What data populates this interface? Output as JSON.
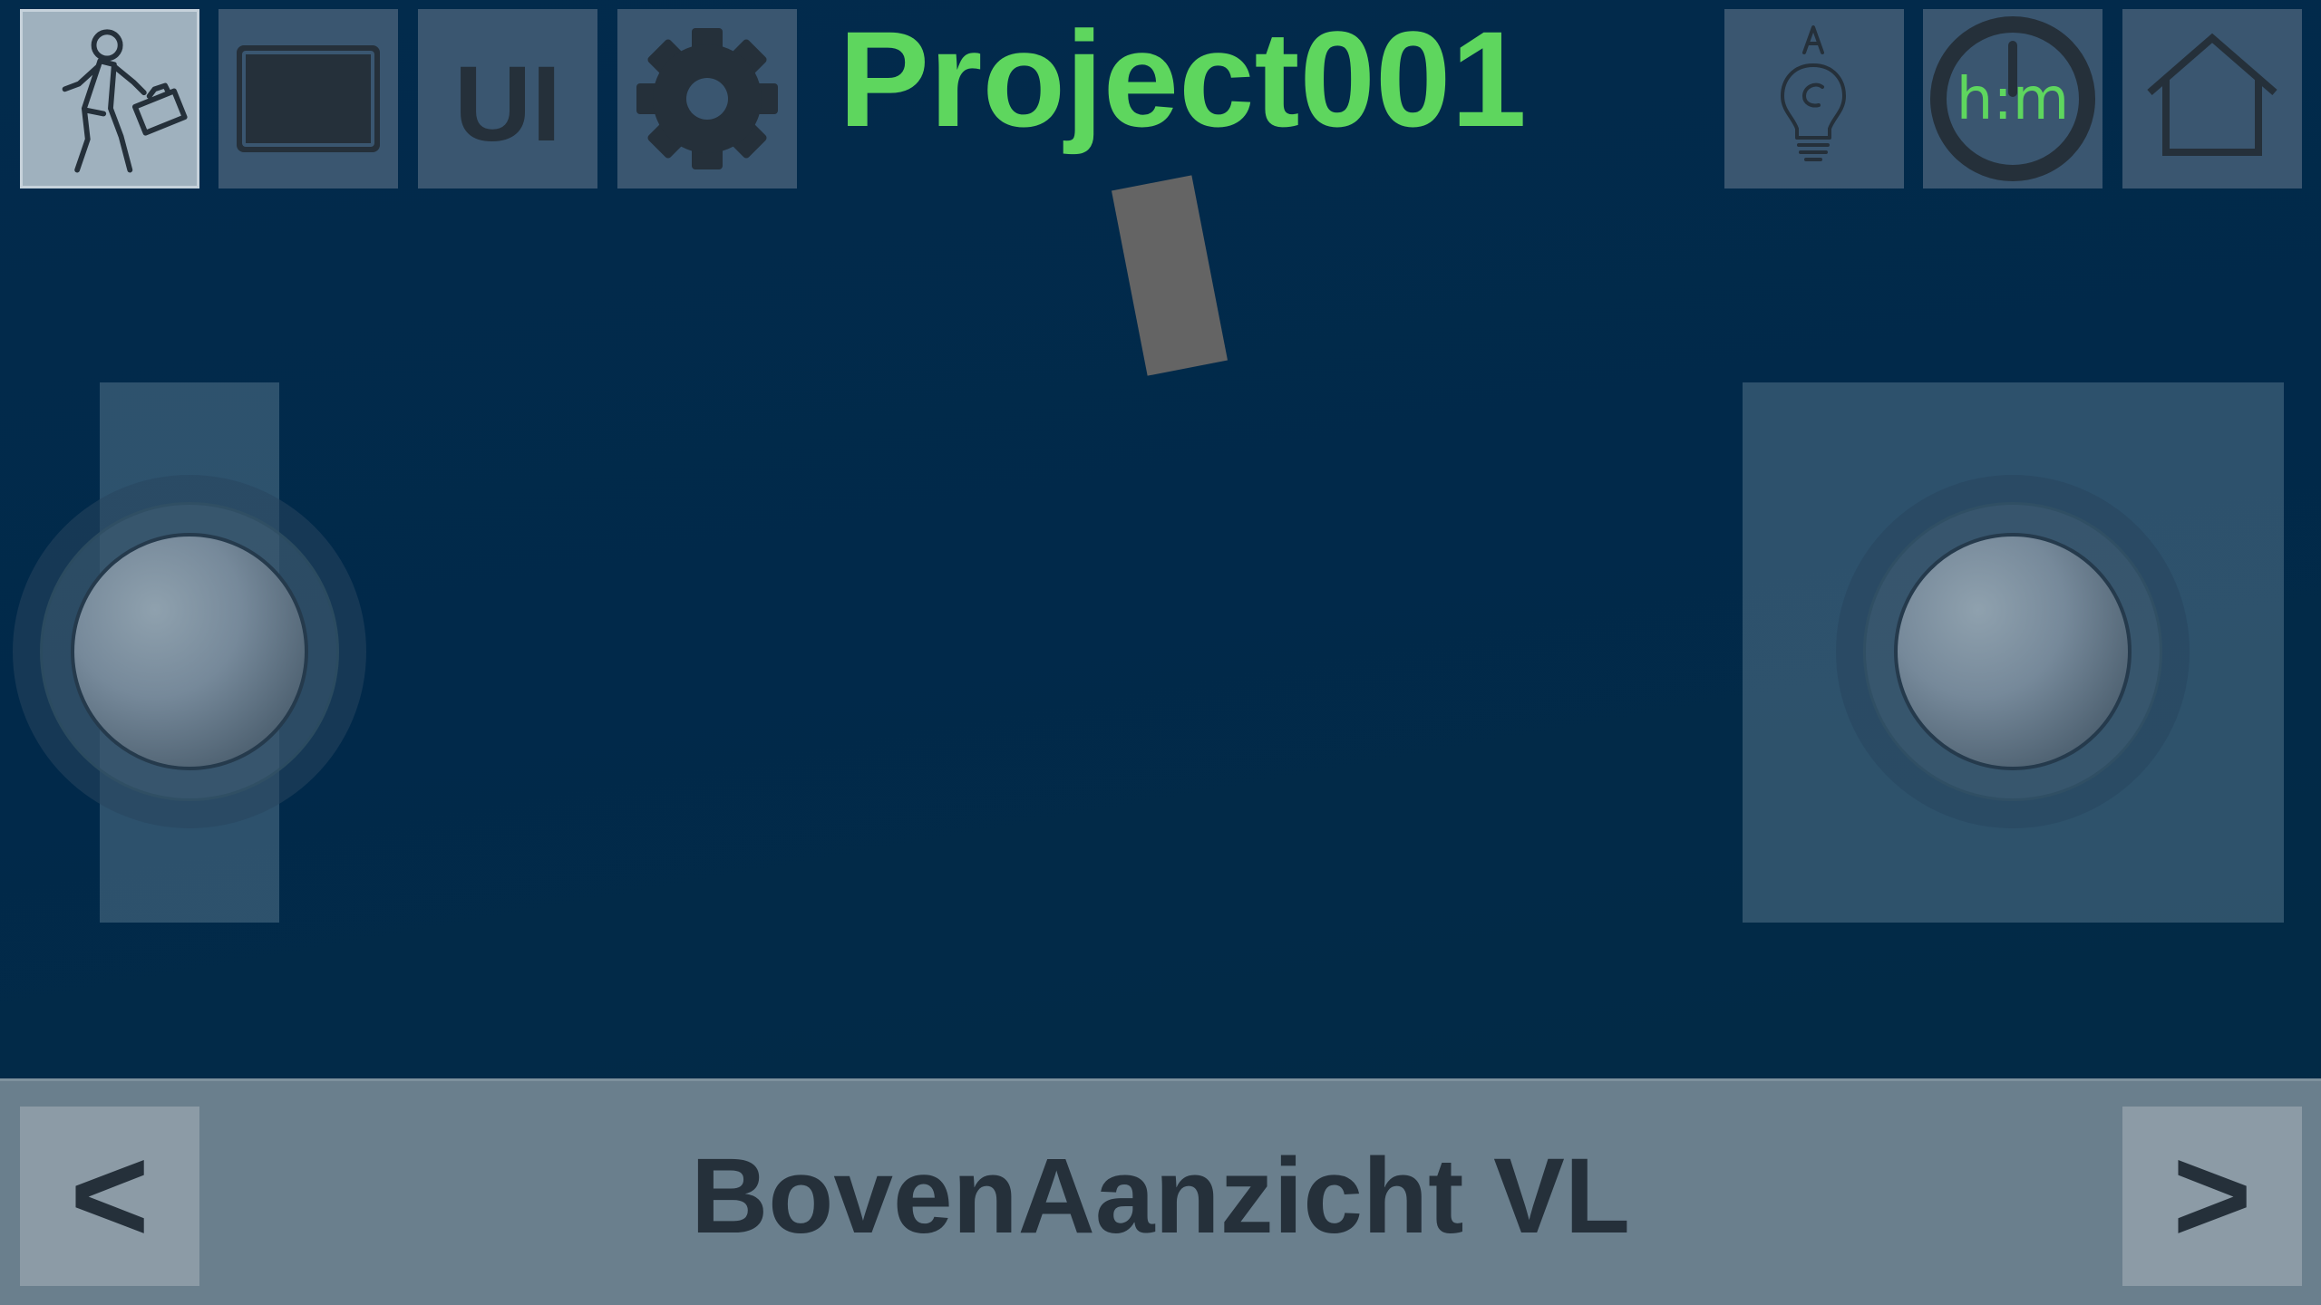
{
  "header": {
    "title": "Project001",
    "title_color": "#5ed65e",
    "toolbar_left": [
      {
        "name": "walk-mode-button",
        "icon": "walking-person-with-briefcase-icon",
        "active": true
      },
      {
        "name": "screen-button",
        "icon": "monitor-screen-icon",
        "active": false
      },
      {
        "name": "ui-button",
        "label": "UI",
        "active": false
      },
      {
        "name": "settings-button",
        "icon": "gear-icon",
        "active": false
      }
    ],
    "toolbar_right": [
      {
        "name": "light-button",
        "icon": "lightbulb-auto-icon",
        "icon_letter": "A"
      },
      {
        "name": "clock-button",
        "icon": "clock-icon",
        "label": "h:m"
      },
      {
        "name": "home-button",
        "icon": "home-icon"
      }
    ]
  },
  "view": {
    "name": "BovenAanzicht VL",
    "prev_label": "<",
    "next_label": ">"
  },
  "colors": {
    "background": "#022b4c",
    "button": "#3a5670",
    "button_active": "#9fb1be",
    "bottom_bar": "#6a7f8d",
    "accent_green": "#5ed65e",
    "dark_text": "#25303a"
  }
}
